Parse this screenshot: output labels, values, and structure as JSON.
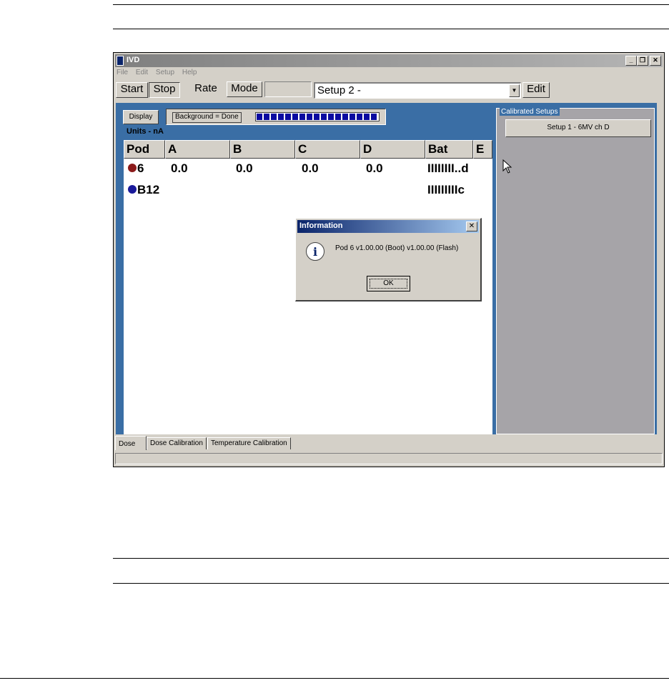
{
  "window": {
    "title": "IVD",
    "controls": {
      "minimize": "_",
      "restore": "❐",
      "close": "✕"
    }
  },
  "menu": [
    "File",
    "Edit",
    "Setup",
    "Help"
  ],
  "toolbar": {
    "start_label": "Start",
    "stop_label": "Stop",
    "rate_label": "Rate",
    "mode_label": "Mode",
    "setup_value": "Setup 2 -",
    "edit_label": "Edit"
  },
  "display_label": "Display",
  "status": {
    "text": "Background = Done",
    "progress": 1.0
  },
  "units": "Units - nA",
  "table": {
    "headers": [
      "Pod",
      "A",
      "B",
      "C",
      "D",
      "Bat",
      "E"
    ],
    "rows": [
      {
        "pod": "6",
        "dot_color": "#8b1a1a",
        "a": "0.0",
        "b": "0.0",
        "c": "0.0",
        "d": "0.0",
        "bat": "IIIIIIII..d"
      },
      {
        "pod": "B12",
        "dot_color": "#1a1a9a",
        "a": "",
        "b": "",
        "c": "",
        "d": "",
        "bat": "IIIIIIIIIc"
      }
    ]
  },
  "calibrated_setups": {
    "label": "Calibrated Setups",
    "items": [
      "Setup 1 - 6MV ch D"
    ]
  },
  "dialog": {
    "title": "Information",
    "message": "Pod 6 v1.00.00 (Boot) v1.00.00 (Flash)",
    "ok_label": "OK",
    "icon": "info-icon"
  },
  "tabs": [
    "Dose",
    "Dose Calibration",
    "Temperature Calibration"
  ],
  "colors": {
    "panel_blue": "#3a6ea5",
    "dialog_title": "#0a246a"
  }
}
